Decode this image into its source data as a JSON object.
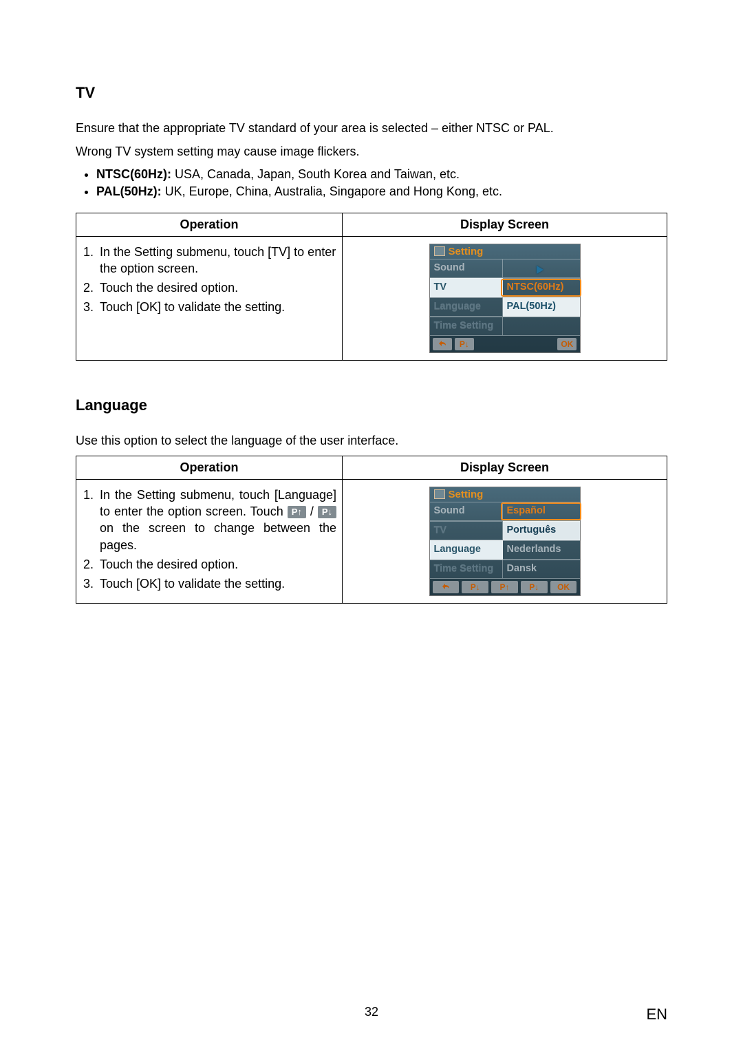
{
  "section_tv": {
    "heading": "TV",
    "intro_1": "Ensure that the appropriate TV standard of your area is selected – either NTSC or PAL.",
    "intro_2": "Wrong TV system setting may cause image flickers.",
    "bullet_ntsc": {
      "label": "NTSC(60Hz):",
      "rest": " USA, Canada, Japan, South Korea and Taiwan, etc."
    },
    "bullet_pal": {
      "label": "PAL(50Hz):",
      "rest": " UK, Europe, China, Australia, Singapore and Hong Kong, etc."
    },
    "table": {
      "head_op": "Operation",
      "head_scr": "Display Screen",
      "steps": [
        "In the Setting submenu, touch [TV] to enter the option screen.",
        "Touch the desired option.",
        "Touch [OK] to validate the setting."
      ]
    },
    "screen": {
      "title": "Setting",
      "left": [
        "Sound",
        "TV",
        "Language",
        "Time Setting"
      ],
      "right": [
        "",
        "NTSC(60Hz)",
        "PAL(50Hz)",
        ""
      ],
      "footer": {
        "back": "↩",
        "pdown": "P↓",
        "ok": "OK"
      }
    }
  },
  "section_lang": {
    "heading": "Language",
    "intro": "Use this option to select the language of the user interface.",
    "table": {
      "head_op": "Operation",
      "head_scr": "Display Screen",
      "step1_a": "In the Setting submenu, touch [Language] to enter the option screen.",
      "step1_b": "Touch ",
      "step1_p_up": "P↑",
      "step1_slash": "/ ",
      "step1_p_dn": "P↓",
      "step1_c": "on the screen to change between the pages.",
      "step2": "Touch the desired option.",
      "step3": "Touch [OK] to validate the setting."
    },
    "screen": {
      "title": "Setting",
      "left": [
        "Sound",
        "TV",
        "Language",
        "Time Setting"
      ],
      "right": [
        "Español",
        "Português",
        "Nederlands",
        "Dansk"
      ],
      "footer": {
        "back": "↩",
        "pdown": "P↓",
        "pup": "P↑",
        "pdown2": "P↓",
        "ok": "OK"
      }
    }
  },
  "page_number": "32",
  "page_lang_label": "EN"
}
